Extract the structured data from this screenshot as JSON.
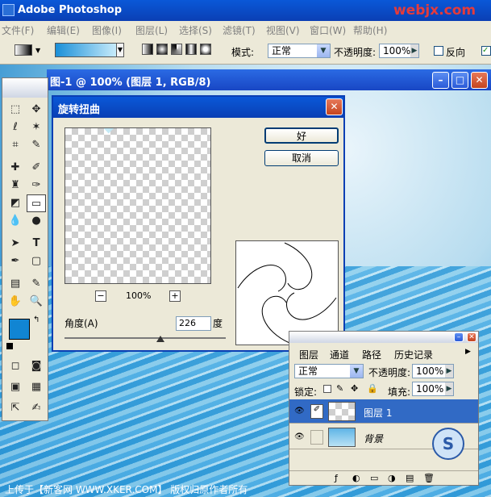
{
  "app": {
    "title": "Adobe Photoshop",
    "watermark": "webjx.com"
  },
  "menu": [
    "文件(F)",
    "编辑(E)",
    "图像(I)",
    "图层(L)",
    "选择(S)",
    "滤镜(T)",
    "视图(V)",
    "窗口(W)",
    "帮助(H)"
  ],
  "options": {
    "mode_label": "模式:",
    "mode_value": "正常",
    "opacity_label": "不透明度:",
    "opacity_value": "100%",
    "reverse_label": "反向"
  },
  "document": {
    "title": "图-1 @ 100% (图层 1, RGB/8)"
  },
  "dialog": {
    "title": "旋转扭曲",
    "ok_label": "好",
    "cancel_label": "取消",
    "zoom_value": "100%",
    "zoom_minus": "−",
    "zoom_plus": "+",
    "angle_label": "角度(A)",
    "angle_value": "226",
    "angle_unit": "度"
  },
  "layers_panel": {
    "tabs": [
      "图层",
      "通道",
      "路径",
      "历史记录"
    ],
    "blend_mode": "正常",
    "opacity_label": "不透明度:",
    "opacity_value": "100%",
    "lock_label": "锁定:",
    "fill_label": "填充:",
    "fill_value": "100%",
    "layers": [
      {
        "name": "图层 1",
        "selected": true
      },
      {
        "name": "背景",
        "selected": false
      }
    ]
  },
  "status_text": "上传于【新客网 WWW.XKER.COM】 版权归原作者所有",
  "colors": {
    "foreground": "#1185d3",
    "background": "#ffffff"
  }
}
